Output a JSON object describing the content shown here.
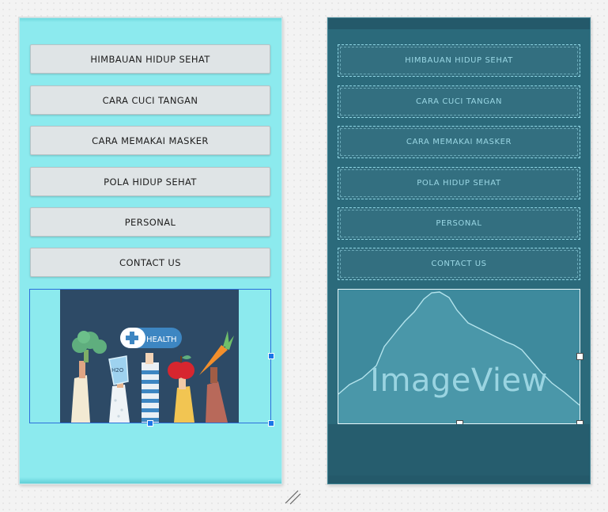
{
  "buttons": [
    {
      "label": "HIMBAUAN HIDUP SEHAT"
    },
    {
      "label": "CARA CUCI TANGAN"
    },
    {
      "label": "CARA MEMAKAI MASKER"
    },
    {
      "label": "POLA HIDUP SEHAT"
    },
    {
      "label": "PERSONAL"
    },
    {
      "label": "CONTACT US"
    }
  ],
  "design_image": {
    "badge_text": "HEALTH",
    "glass_label": "H2O"
  },
  "blueprint_image": {
    "label": "ImageView"
  },
  "colors": {
    "design_background": "#8ceaee",
    "blueprint_background": "#2b6a7b",
    "selection_blue": "#1a75e8",
    "illustration_background": "#2d4a66"
  },
  "icons": {
    "resize_grip": "resize-grip-icon"
  }
}
